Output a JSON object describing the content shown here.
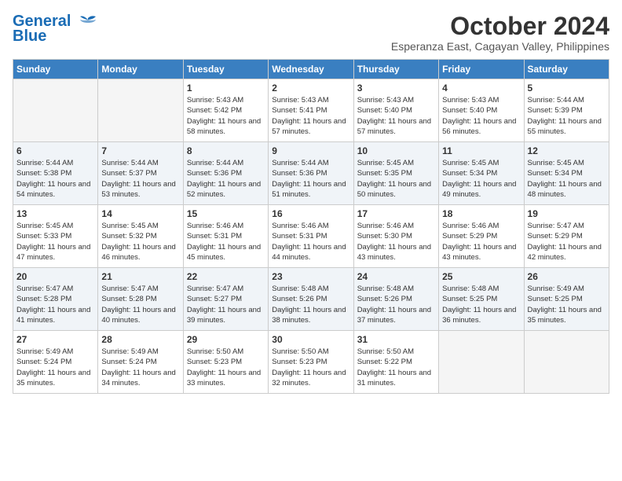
{
  "header": {
    "logo_line1": "General",
    "logo_line2": "Blue",
    "month": "October 2024",
    "location": "Esperanza East, Cagayan Valley, Philippines"
  },
  "weekdays": [
    "Sunday",
    "Monday",
    "Tuesday",
    "Wednesday",
    "Thursday",
    "Friday",
    "Saturday"
  ],
  "weeks": [
    [
      {
        "day": "",
        "info": ""
      },
      {
        "day": "",
        "info": ""
      },
      {
        "day": "1",
        "info": "Sunrise: 5:43 AM\nSunset: 5:42 PM\nDaylight: 11 hours and 58 minutes."
      },
      {
        "day": "2",
        "info": "Sunrise: 5:43 AM\nSunset: 5:41 PM\nDaylight: 11 hours and 57 minutes."
      },
      {
        "day": "3",
        "info": "Sunrise: 5:43 AM\nSunset: 5:40 PM\nDaylight: 11 hours and 57 minutes."
      },
      {
        "day": "4",
        "info": "Sunrise: 5:43 AM\nSunset: 5:40 PM\nDaylight: 11 hours and 56 minutes."
      },
      {
        "day": "5",
        "info": "Sunrise: 5:44 AM\nSunset: 5:39 PM\nDaylight: 11 hours and 55 minutes."
      }
    ],
    [
      {
        "day": "6",
        "info": "Sunrise: 5:44 AM\nSunset: 5:38 PM\nDaylight: 11 hours and 54 minutes."
      },
      {
        "day": "7",
        "info": "Sunrise: 5:44 AM\nSunset: 5:37 PM\nDaylight: 11 hours and 53 minutes."
      },
      {
        "day": "8",
        "info": "Sunrise: 5:44 AM\nSunset: 5:36 PM\nDaylight: 11 hours and 52 minutes."
      },
      {
        "day": "9",
        "info": "Sunrise: 5:44 AM\nSunset: 5:36 PM\nDaylight: 11 hours and 51 minutes."
      },
      {
        "day": "10",
        "info": "Sunrise: 5:45 AM\nSunset: 5:35 PM\nDaylight: 11 hours and 50 minutes."
      },
      {
        "day": "11",
        "info": "Sunrise: 5:45 AM\nSunset: 5:34 PM\nDaylight: 11 hours and 49 minutes."
      },
      {
        "day": "12",
        "info": "Sunrise: 5:45 AM\nSunset: 5:34 PM\nDaylight: 11 hours and 48 minutes."
      }
    ],
    [
      {
        "day": "13",
        "info": "Sunrise: 5:45 AM\nSunset: 5:33 PM\nDaylight: 11 hours and 47 minutes."
      },
      {
        "day": "14",
        "info": "Sunrise: 5:45 AM\nSunset: 5:32 PM\nDaylight: 11 hours and 46 minutes."
      },
      {
        "day": "15",
        "info": "Sunrise: 5:46 AM\nSunset: 5:31 PM\nDaylight: 11 hours and 45 minutes."
      },
      {
        "day": "16",
        "info": "Sunrise: 5:46 AM\nSunset: 5:31 PM\nDaylight: 11 hours and 44 minutes."
      },
      {
        "day": "17",
        "info": "Sunrise: 5:46 AM\nSunset: 5:30 PM\nDaylight: 11 hours and 43 minutes."
      },
      {
        "day": "18",
        "info": "Sunrise: 5:46 AM\nSunset: 5:29 PM\nDaylight: 11 hours and 43 minutes."
      },
      {
        "day": "19",
        "info": "Sunrise: 5:47 AM\nSunset: 5:29 PM\nDaylight: 11 hours and 42 minutes."
      }
    ],
    [
      {
        "day": "20",
        "info": "Sunrise: 5:47 AM\nSunset: 5:28 PM\nDaylight: 11 hours and 41 minutes."
      },
      {
        "day": "21",
        "info": "Sunrise: 5:47 AM\nSunset: 5:28 PM\nDaylight: 11 hours and 40 minutes."
      },
      {
        "day": "22",
        "info": "Sunrise: 5:47 AM\nSunset: 5:27 PM\nDaylight: 11 hours and 39 minutes."
      },
      {
        "day": "23",
        "info": "Sunrise: 5:48 AM\nSunset: 5:26 PM\nDaylight: 11 hours and 38 minutes."
      },
      {
        "day": "24",
        "info": "Sunrise: 5:48 AM\nSunset: 5:26 PM\nDaylight: 11 hours and 37 minutes."
      },
      {
        "day": "25",
        "info": "Sunrise: 5:48 AM\nSunset: 5:25 PM\nDaylight: 11 hours and 36 minutes."
      },
      {
        "day": "26",
        "info": "Sunrise: 5:49 AM\nSunset: 5:25 PM\nDaylight: 11 hours and 35 minutes."
      }
    ],
    [
      {
        "day": "27",
        "info": "Sunrise: 5:49 AM\nSunset: 5:24 PM\nDaylight: 11 hours and 35 minutes."
      },
      {
        "day": "28",
        "info": "Sunrise: 5:49 AM\nSunset: 5:24 PM\nDaylight: 11 hours and 34 minutes."
      },
      {
        "day": "29",
        "info": "Sunrise: 5:50 AM\nSunset: 5:23 PM\nDaylight: 11 hours and 33 minutes."
      },
      {
        "day": "30",
        "info": "Sunrise: 5:50 AM\nSunset: 5:23 PM\nDaylight: 11 hours and 32 minutes."
      },
      {
        "day": "31",
        "info": "Sunrise: 5:50 AM\nSunset: 5:22 PM\nDaylight: 11 hours and 31 minutes."
      },
      {
        "day": "",
        "info": ""
      },
      {
        "day": "",
        "info": ""
      }
    ]
  ]
}
